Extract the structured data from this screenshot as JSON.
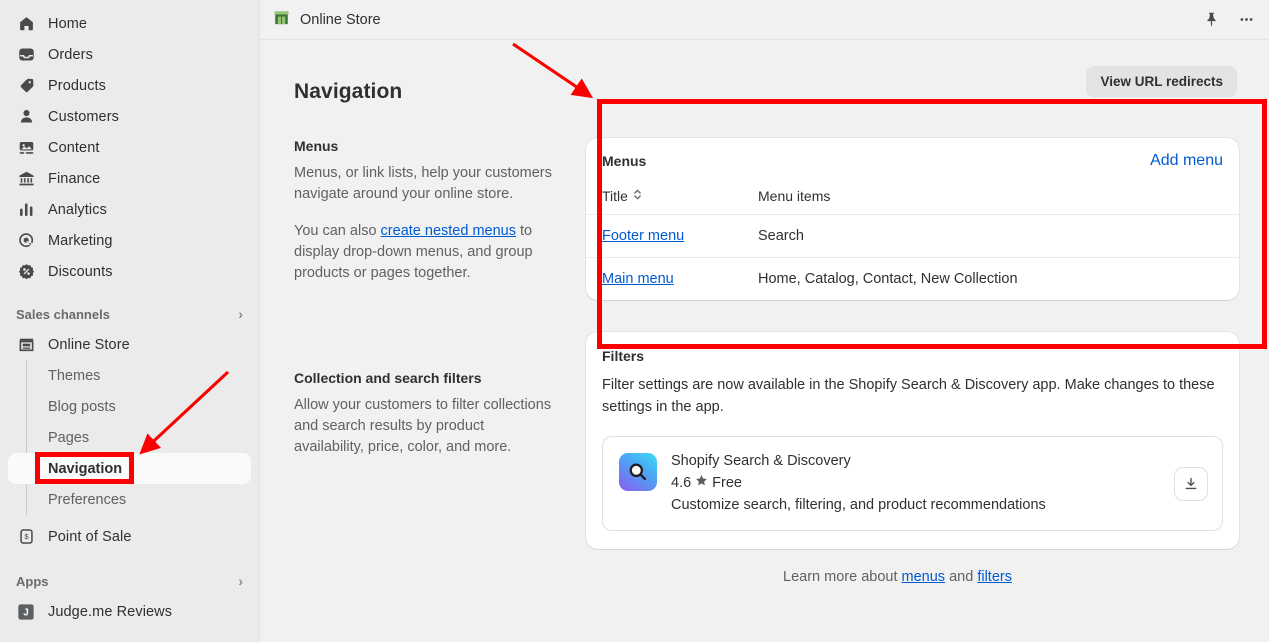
{
  "sidebar": {
    "primary_items": [
      {
        "label": "Home",
        "icon": "home-icon"
      },
      {
        "label": "Orders",
        "icon": "orders-icon"
      },
      {
        "label": "Products",
        "icon": "products-tag-icon"
      },
      {
        "label": "Customers",
        "icon": "customers-person-icon"
      },
      {
        "label": "Content",
        "icon": "content-media-icon"
      },
      {
        "label": "Finance",
        "icon": "finance-bank-icon"
      },
      {
        "label": "Analytics",
        "icon": "analytics-bars-icon"
      },
      {
        "label": "Marketing",
        "icon": "marketing-target-icon"
      },
      {
        "label": "Discounts",
        "icon": "discounts-badge-icon"
      }
    ],
    "sales_channels": {
      "heading": "Sales channels",
      "chevron_icon": "chevron-right-icon",
      "online_store": {
        "label": "Online Store",
        "icon": "online-store-icon"
      },
      "sub_items": [
        {
          "label": "Themes",
          "active": false
        },
        {
          "label": "Blog posts",
          "active": false
        },
        {
          "label": "Pages",
          "active": false
        },
        {
          "label": "Navigation",
          "active": true
        },
        {
          "label": "Preferences",
          "active": false
        }
      ],
      "point_of_sale": {
        "label": "Point of Sale",
        "icon": "point-of-sale-icon"
      }
    },
    "apps": {
      "heading": "Apps",
      "chevron_icon": "chevron-right-icon",
      "items": [
        {
          "label": "Judge.me Reviews",
          "icon": "judgeme-icon",
          "initial": "J"
        }
      ]
    }
  },
  "topbar": {
    "store_name": "Online Store",
    "store_icon": "storefront-icon",
    "pin_icon": "pin-icon",
    "more_icon": "more-horizontal-icon"
  },
  "page": {
    "title": "Navigation",
    "view_url_redirects_label": "View URL redirects"
  },
  "left_column": {
    "menus_section": {
      "title": "Menus",
      "paragraph_1": "Menus, or link lists, help your customers navigate around your online store.",
      "paragraph_2_before": "You can also ",
      "paragraph_2_link": "create nested menus",
      "paragraph_2_after": " to display drop-down menus, and group products or pages together."
    },
    "filters_section": {
      "title": "Collection and search filters",
      "paragraph": "Allow your customers to filter collections and search results by product availability, price, color, and more."
    }
  },
  "menus_card": {
    "title": "Menus",
    "add_menu_label": "Add menu",
    "columns": [
      {
        "label": "Title",
        "sort_icon": "sort-chevrons-icon"
      },
      {
        "label": "Menu items"
      }
    ],
    "rows": [
      {
        "title": "Footer menu",
        "items": "Search"
      },
      {
        "title": "Main menu",
        "items": "Home, Catalog, Contact, New Collection"
      }
    ]
  },
  "filters_card": {
    "title": "Filters",
    "description": "Filter settings are now available in the Shopify Search & Discovery app. Make changes to these settings in the app.",
    "app": {
      "name": "Shopify Search & Discovery",
      "rating": "4.6",
      "star_icon": "star-icon",
      "price": "Free",
      "description": "Customize search, filtering, and product recommendations",
      "icon": "magnifier-app-icon",
      "install_icon": "download-icon"
    }
  },
  "footer": {
    "learn_more_prefix": "Learn more about ",
    "link_menus": "menus",
    "and_text": " and ",
    "link_filters": "filters"
  },
  "colors": {
    "accent_link": "#005bd3",
    "annotation_red": "#fb0000",
    "sidebar_bg": "#ebebeb",
    "page_bg": "#f1f1f1",
    "card_bg": "#ffffff"
  }
}
